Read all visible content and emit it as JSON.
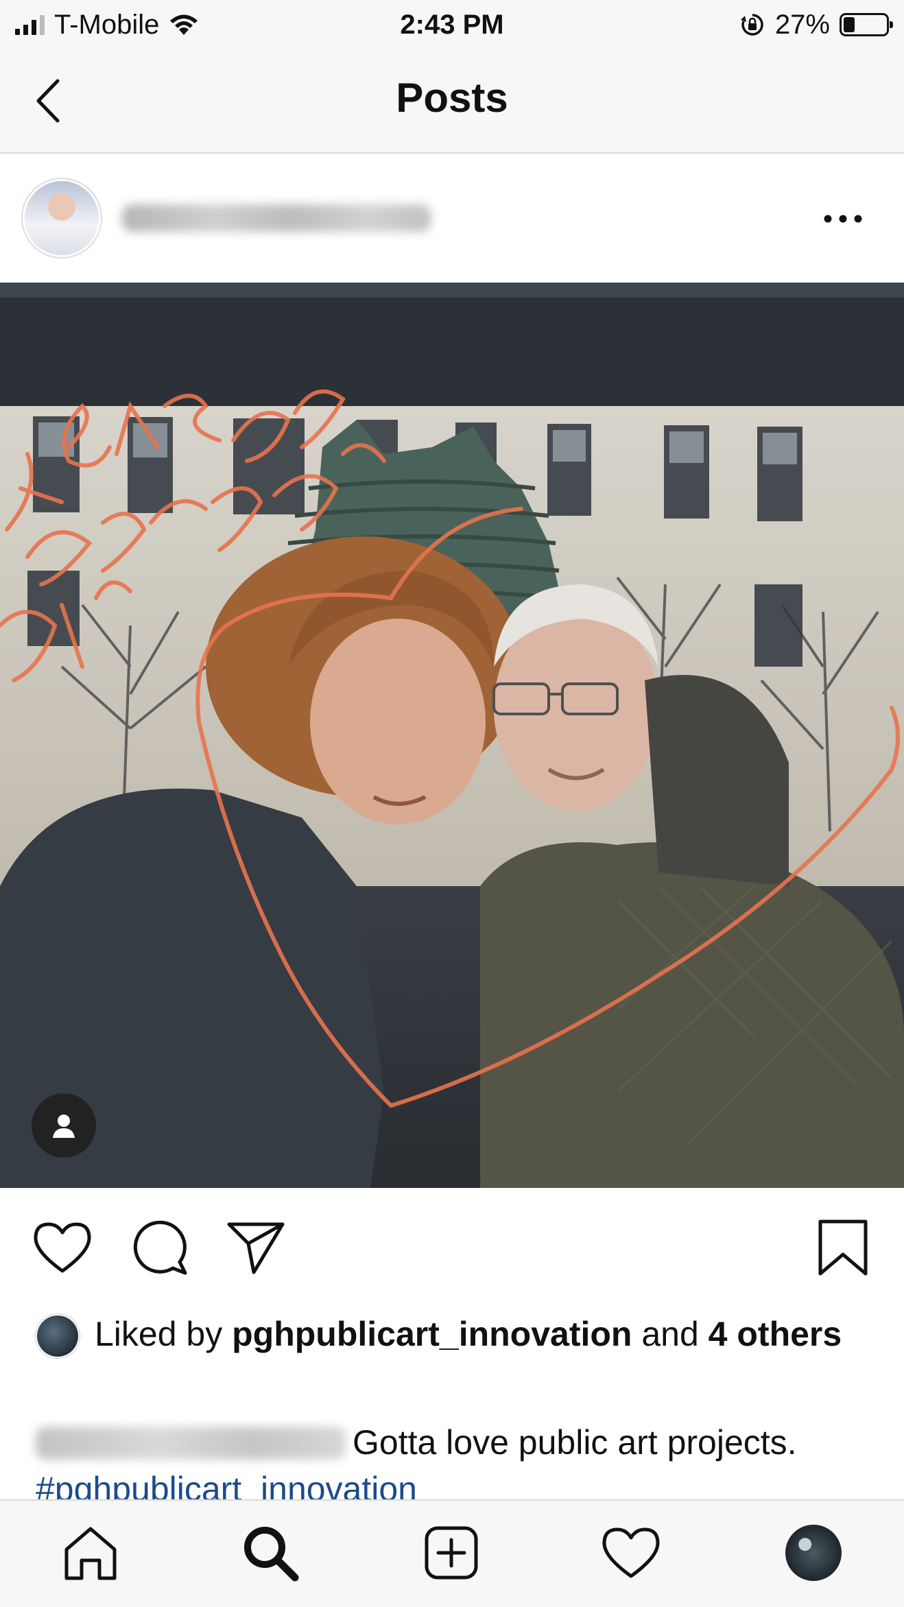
{
  "status_bar": {
    "carrier": "T-Mobile",
    "time": "2:43 PM",
    "battery_percent": "27%",
    "battery_level": 0.27,
    "icons": [
      "signal-icon",
      "wifi-icon",
      "orientation-lock-icon",
      "battery-icon"
    ]
  },
  "nav": {
    "title": "Posts",
    "back_icon": "chevron-left-icon"
  },
  "post": {
    "more_icon": "more-horizontal-icon",
    "image_icon": "user-tag-icon",
    "actions": [
      "heart-icon",
      "comment-icon",
      "share-icon",
      "bookmark-icon"
    ],
    "likes": {
      "prefix": "Liked by ",
      "user": "pghpublicart_innovation",
      "middle": " and ",
      "count_text": "4 others"
    },
    "caption": {
      "text": "Gotta love public art projects.",
      "hashtag": "#pghpublicart_innovation"
    }
  },
  "tab_bar": {
    "icons": [
      "home-icon",
      "search-icon",
      "new-post-icon",
      "activity-heart-icon",
      "profile-avatar"
    ]
  },
  "colors": {
    "bar_background": "#f7f7f7",
    "divider": "#d9d9d9",
    "hashtag": "#1a4b8c",
    "window_drawing": "#e8734d"
  }
}
